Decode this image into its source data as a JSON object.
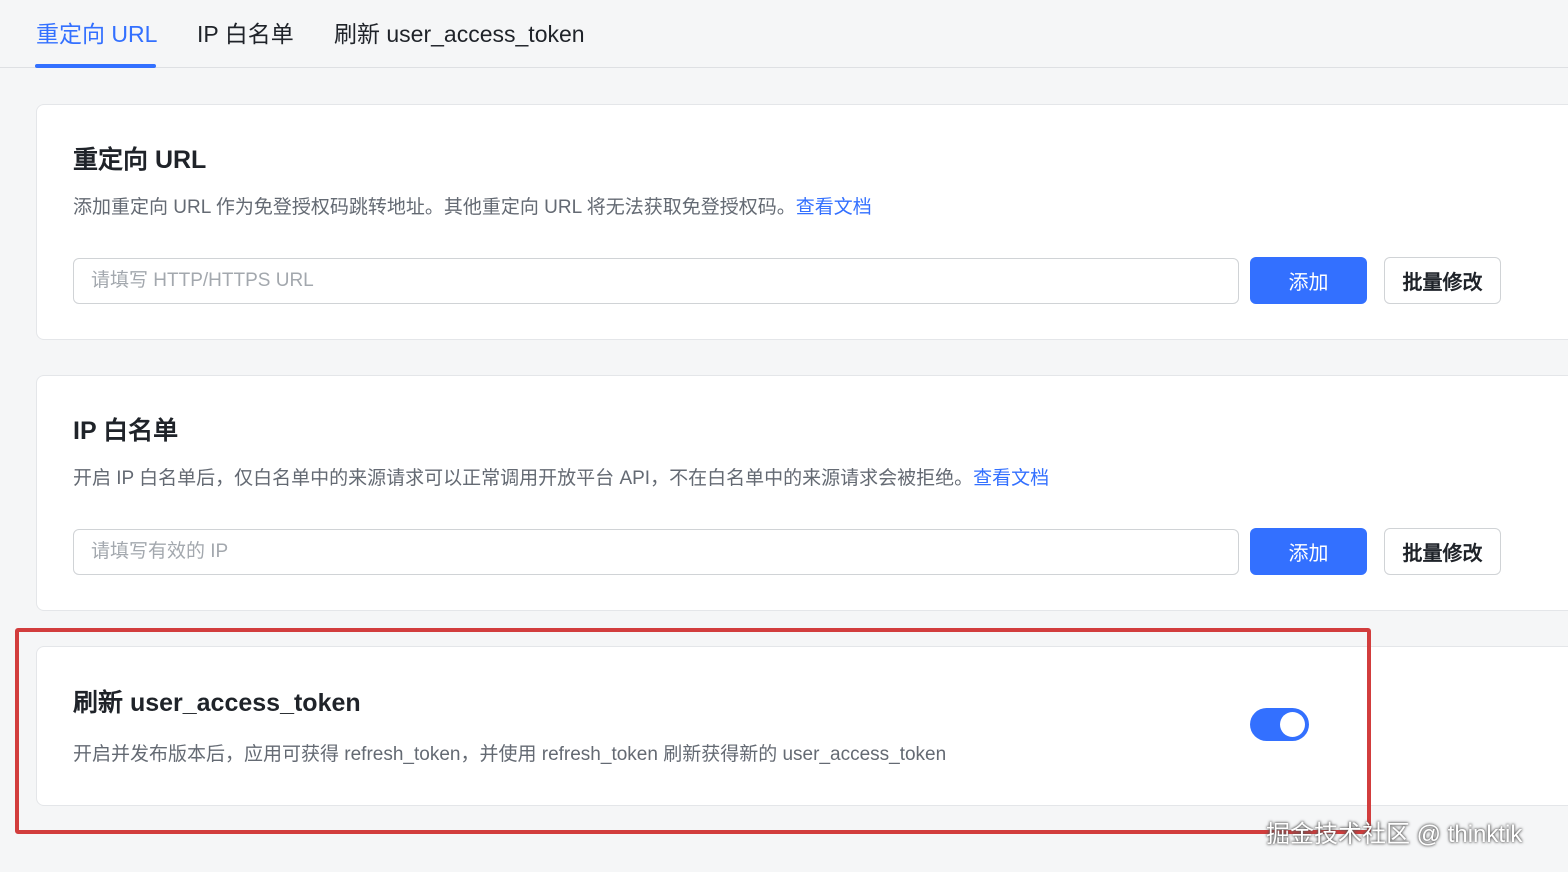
{
  "tabs": [
    {
      "label": "重定向 URL",
      "active": true
    },
    {
      "label": "IP 白名单",
      "active": false
    },
    {
      "label": "刷新 user_access_token",
      "active": false
    }
  ],
  "redirect": {
    "title": "重定向 URL",
    "desc": "添加重定向 URL 作为免登授权码跳转地址。其他重定向 URL 将无法获取免登授权码。",
    "link": "查看文档",
    "placeholder": "请填写 HTTP/HTTPS URL",
    "value": "",
    "add_label": "添加",
    "batch_label": "批量修改"
  },
  "ip_whitelist": {
    "title": "IP 白名单",
    "desc": "开启 IP 白名单后，仅白名单中的来源请求可以正常调用开放平台 API，不在白名单中的来源请求会被拒绝。",
    "link": "查看文档",
    "placeholder": "请填写有效的 IP",
    "value": "",
    "add_label": "添加",
    "batch_label": "批量修改"
  },
  "refresh_token": {
    "title": "刷新 user_access_token",
    "desc": "开启并发布版本后，应用可获得 refresh_token，并使用 refresh_token 刷新获得新的 user_access_token",
    "toggle_on": true
  },
  "watermark": "掘金技术社区 @ thinktik",
  "colors": {
    "accent": "#3370ff",
    "highlight": "#d23d3d"
  }
}
